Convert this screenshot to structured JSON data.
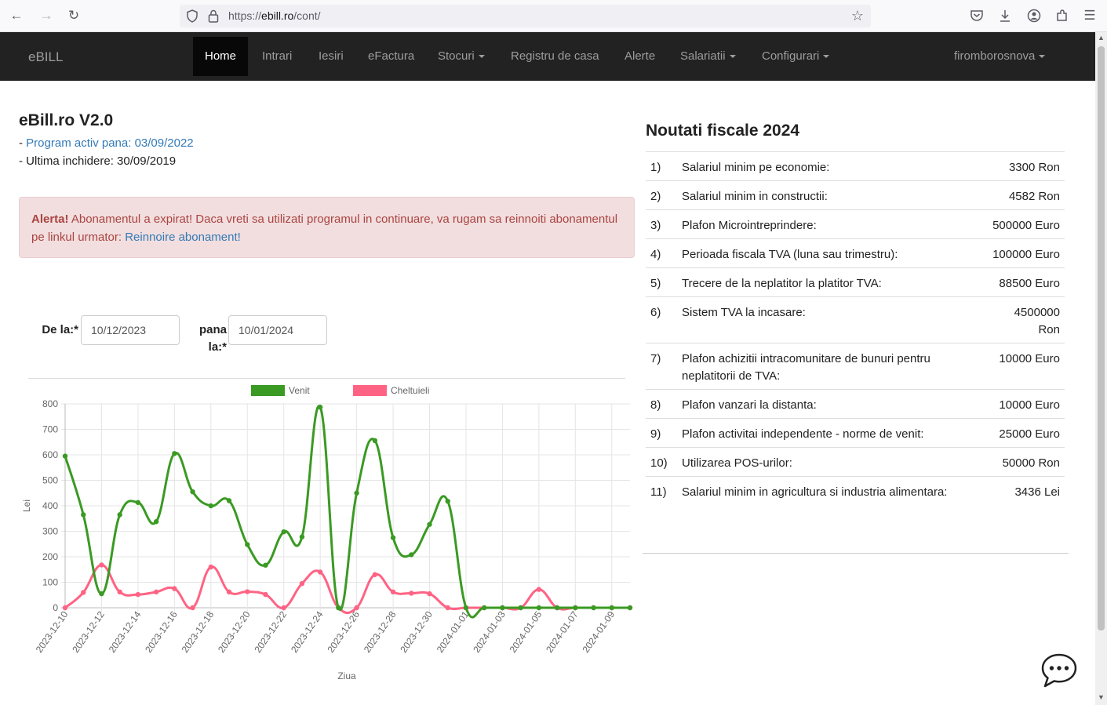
{
  "browser": {
    "url_prefix": "https://",
    "url_host": "ebill.ro",
    "url_path": "/cont/"
  },
  "navbar": {
    "brand": "eBILL",
    "items": [
      {
        "label": "Home",
        "active": true
      },
      {
        "label": "Intrari"
      },
      {
        "label": "Iesiri"
      },
      {
        "label": "eFactura"
      },
      {
        "label": "Stocuri",
        "dropdown": true
      },
      {
        "label": "Registru de casa"
      },
      {
        "label": "Alerte"
      },
      {
        "label": "Salariatii",
        "dropdown": true
      },
      {
        "label": "Configurari",
        "dropdown": true
      }
    ],
    "user": "firomborosnova"
  },
  "main": {
    "title": "eBill.ro V2.0",
    "active_dash": "- ",
    "active_link": "Program activ pana: 03/09/2022",
    "last_close": "- Ultima inchidere: 30/09/2019",
    "alert": {
      "label": "Alerta!",
      "text": " Abonamentul a expirat! Daca vreti sa utilizati programul in continuare, va rugam sa reinnoiti abonamentul pe linkul urmator: ",
      "link": "Reinnoire abonament!"
    },
    "form": {
      "from_label": "De la:*",
      "from_value": "10/12/2023",
      "to_label_1": "pana",
      "to_label_2": "la:*",
      "to_value": "10/01/2024"
    }
  },
  "news": {
    "title": "Noutati fiscale 2024",
    "rows": [
      {
        "num": "1)",
        "label": "Salariul minim pe economie:",
        "value": "3300 Ron"
      },
      {
        "num": "2)",
        "label": "Salariul minim in constructii:",
        "value": "4582 Ron"
      },
      {
        "num": "3)",
        "label": "Plafon Microintreprindere:",
        "value": "500000 Euro"
      },
      {
        "num": "4)",
        "label": "Perioada fiscala TVA (luna sau trimestru):",
        "value": "100000 Euro"
      },
      {
        "num": "5)",
        "label": "Trecere de la neplatitor la platitor TVA:",
        "value": "88500 Euro"
      },
      {
        "num": "6)",
        "label": "Sistem TVA la incasare:",
        "value": "4500000 Ron"
      },
      {
        "num": "7)",
        "label": "Plafon achizitii intracomunitare de bunuri pentru neplatitorii de TVA:",
        "value": "10000 Euro"
      },
      {
        "num": "8)",
        "label": "Plafon vanzari la distanta:",
        "value": "10000 Euro"
      },
      {
        "num": "9)",
        "label": "Plafon activitai independente - norme de venit:",
        "value": "25000 Euro"
      },
      {
        "num": "10)",
        "label": "Utilizarea POS-urilor:",
        "value": "50000 Ron"
      },
      {
        "num": "11)",
        "label": "Salariul minim in agricultura si industria alimentara:",
        "value": "3436 Lei"
      }
    ]
  },
  "chart_data": {
    "type": "line",
    "xlabel": "Ziua",
    "ylabel": "Lei",
    "ylim": [
      0,
      800
    ],
    "yticks": [
      0,
      100,
      200,
      300,
      400,
      500,
      600,
      700,
      800
    ],
    "grid": true,
    "legend_position": "top",
    "x": [
      "2023-12-10",
      "2023-12-11",
      "2023-12-12",
      "2023-12-13",
      "2023-12-14",
      "2023-12-15",
      "2023-12-16",
      "2023-12-17",
      "2023-12-18",
      "2023-12-19",
      "2023-12-20",
      "2023-12-21",
      "2023-12-22",
      "2023-12-23",
      "2023-12-24",
      "2023-12-25",
      "2023-12-26",
      "2023-12-27",
      "2023-12-28",
      "2023-12-29",
      "2023-12-30",
      "2023-12-31",
      "2024-01-01",
      "2024-01-02",
      "2024-01-03",
      "2024-01-04",
      "2024-01-05",
      "2024-01-06",
      "2024-01-07",
      "2024-01-08",
      "2024-01-09",
      "2024-01-10"
    ],
    "series": [
      {
        "name": "Venit",
        "color": "#3a9a23",
        "values": [
          595,
          365,
          55,
          365,
          413,
          338,
          605,
          455,
          400,
          420,
          248,
          167,
          298,
          278,
          787,
          0,
          450,
          656,
          275,
          208,
          327,
          418,
          0,
          0,
          0,
          0,
          0,
          0,
          0,
          0,
          0,
          0
        ]
      },
      {
        "name": "Cheltuieli",
        "color": "#ff6384",
        "values": [
          0,
          60,
          168,
          62,
          52,
          62,
          75,
          0,
          160,
          62,
          63,
          52,
          0,
          95,
          140,
          0,
          0,
          130,
          62,
          57,
          55,
          0,
          0,
          0,
          0,
          0,
          72,
          0,
          0,
          0,
          0,
          0
        ]
      }
    ]
  }
}
